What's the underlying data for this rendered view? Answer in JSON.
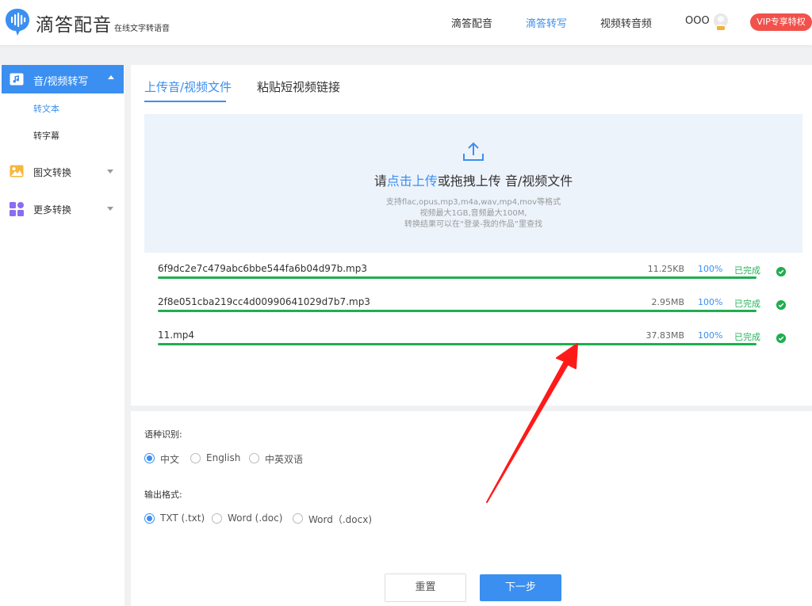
{
  "header": {
    "brand": "滴答配音",
    "tagline": "在线文字转语音",
    "nav": [
      "滴答配音",
      "滴答转写",
      "视频转音频"
    ],
    "active_nav": 1,
    "username": "OOO",
    "vip_label": "VIP专享特权"
  },
  "sidebar": {
    "active": {
      "label": "音/视频转写",
      "icon": "audio-video-icon"
    },
    "subitems": [
      {
        "label": "转文本",
        "active": true
      },
      {
        "label": "转字幕",
        "active": false
      }
    ],
    "groups": [
      {
        "label": "图文转换",
        "icon": "image-icon"
      },
      {
        "label": "更多转换",
        "icon": "grid-icon"
      }
    ]
  },
  "tabs": {
    "upload": "上传音/视频文件",
    "link": "粘贴短视频链接"
  },
  "dropzone": {
    "prefix": "请",
    "link": "点击上传",
    "suffix": "或拖拽上传 音/视频文件",
    "hint1": "支持flac,opus,mp3,m4a,wav,mp4,mov等格式",
    "hint2": "视频最大1GB,音频最大100M,",
    "hint3": "转换结果可以在“登录-我的作品”里查找"
  },
  "files": [
    {
      "name": "6f9dc2e7c479abc6bbe544fa6b04d97b.mp3",
      "size": "11.25KB",
      "percent": "100%",
      "progress": 1.0,
      "status": "已完成"
    },
    {
      "name": "2f8e051cba219cc4d00990641029d7b7.mp3",
      "size": "2.95MB",
      "percent": "100%",
      "progress": 1.0,
      "status": "已完成"
    },
    {
      "name": "11.mp4",
      "size": "37.83MB",
      "percent": "100%",
      "progress": 1.0,
      "status": "已完成"
    }
  ],
  "options": {
    "language_label": "语种识别:",
    "languages": [
      {
        "label": "中文",
        "checked": true
      },
      {
        "label": "English",
        "checked": false
      },
      {
        "label": "中英双语",
        "checked": false
      }
    ],
    "format_label": "输出格式:",
    "formats": [
      {
        "label": "TXT (.txt)",
        "checked": true
      },
      {
        "label": "Word (.doc)",
        "checked": false
      },
      {
        "label": "Word（.docx)",
        "checked": false
      }
    ]
  },
  "buttons": {
    "reset": "重置",
    "next": "下一步"
  },
  "colors": {
    "accent": "#3b8ff0",
    "success": "#1fae4f",
    "vip": "#f2514b",
    "annotation": "#ff1a1a"
  }
}
